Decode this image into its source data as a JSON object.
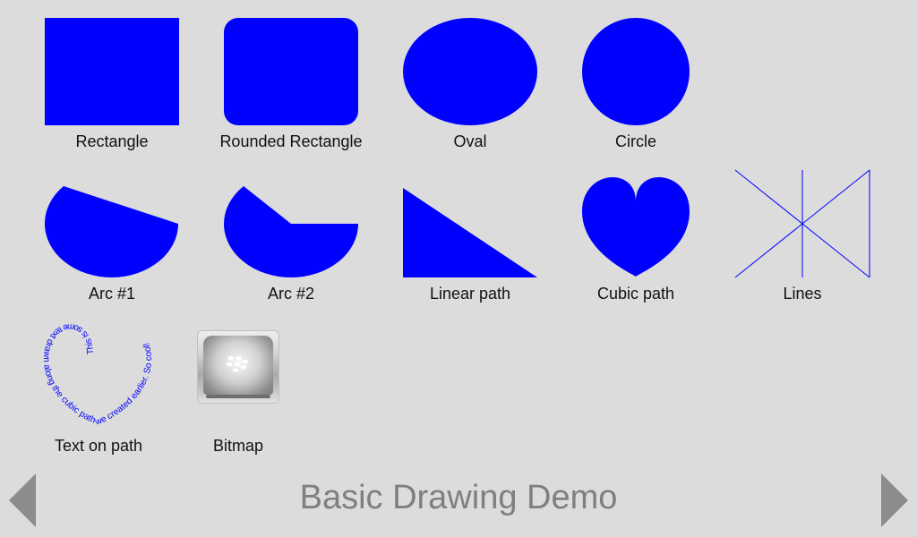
{
  "app": {
    "title": "Basic Drawing Demo"
  },
  "colors": {
    "shape_fill": "#0000ff",
    "background": "#dcdcdc",
    "title": "#7f7f7f",
    "arrow": "#8c8c8c"
  },
  "demos": {
    "rectangle": "Rectangle",
    "rounded_rectangle": "Rounded Rectangle",
    "oval": "Oval",
    "circle": "Circle",
    "arc1": "Arc #1",
    "arc2": "Arc #2",
    "linear_path": "Linear path",
    "cubic_path": "Cubic path",
    "lines": "Lines",
    "text_on_path": "Text on path",
    "bitmap": "Bitmap"
  },
  "text_on_path": {
    "text": "This is some text drawn along the cubic path we created earlier. So cool!"
  },
  "nav": {
    "prev_icon": "triangle-left-icon",
    "next_icon": "triangle-right-icon"
  }
}
